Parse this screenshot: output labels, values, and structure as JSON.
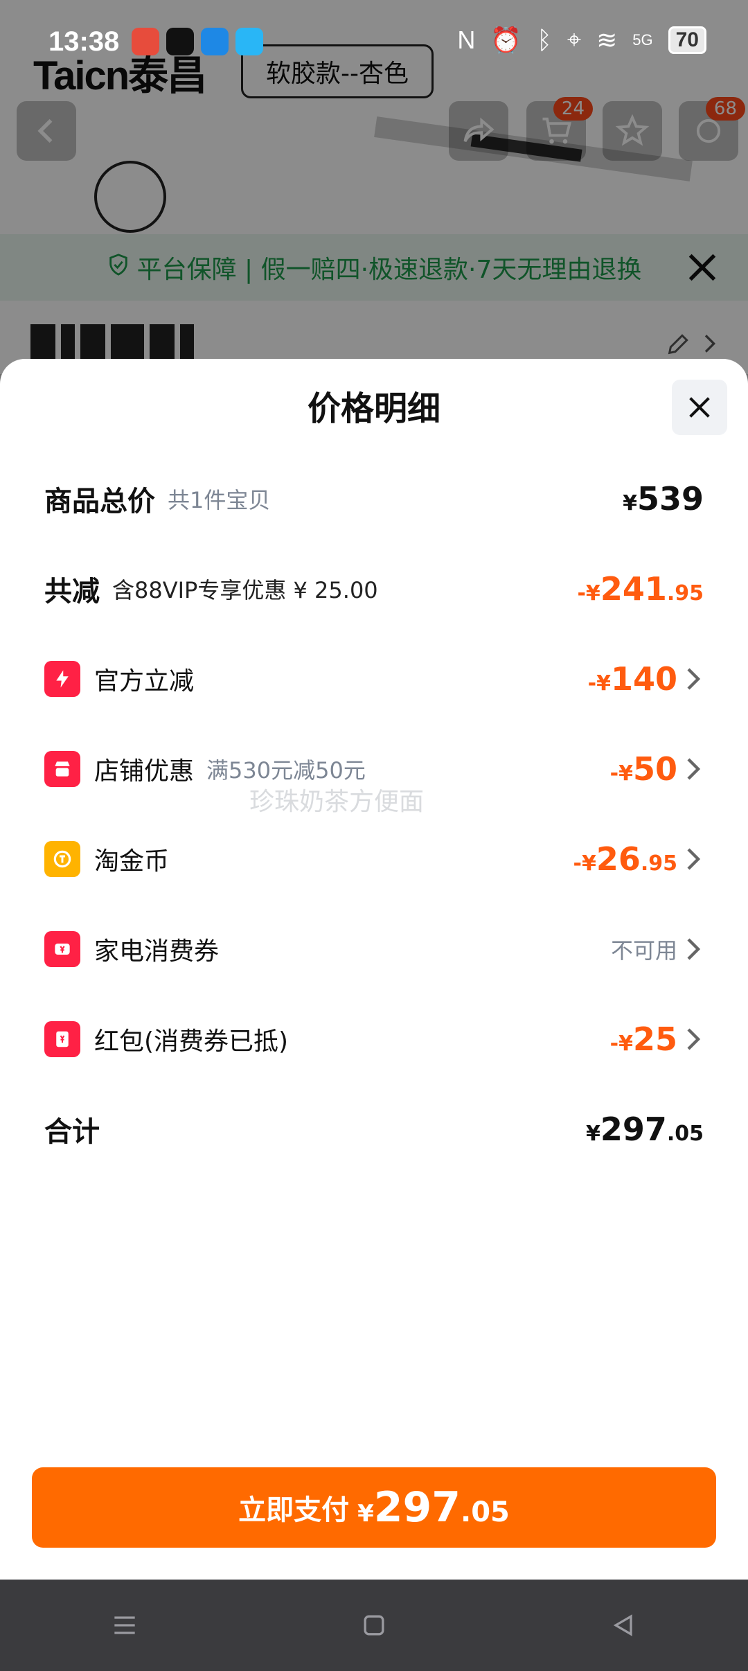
{
  "status_bar": {
    "time": "13:38",
    "battery": "70",
    "signal": "5G"
  },
  "background": {
    "brand": "Taicn泰昌",
    "variant": "软胶款--杏色",
    "cart_badge": "24",
    "message_badge": "68",
    "guarantee_text": "平台保障 | 假一赔四·极速退款·7天无理由退换"
  },
  "sheet": {
    "title": "价格明细",
    "watermark": "珍珠奶茶方便面",
    "total": {
      "label": "商品总价",
      "sub": "共1件宝贝",
      "symbol": "¥",
      "int": "539",
      "dec": ""
    },
    "reduction": {
      "label": "共减",
      "sub": "含88VIP专享优惠 ¥ 25.00",
      "symbol": "-¥",
      "int": "241",
      "dec": ".95"
    },
    "items": [
      {
        "label": "官方立减",
        "sub": "",
        "symbol": "-¥",
        "int": "140",
        "dec": "",
        "icon": "lightning-icon",
        "color": "#ff2145"
      },
      {
        "label": "店铺优惠",
        "sub": "满530元减50元",
        "symbol": "-¥",
        "int": "50",
        "dec": "",
        "icon": "store-icon",
        "color": "#ff2145"
      },
      {
        "label": "淘金币",
        "sub": "",
        "symbol": "-¥",
        "int": "26",
        "dec": ".95",
        "icon": "coin-icon",
        "color": "#ffb300"
      },
      {
        "label": "家电消费券",
        "sub": "",
        "status": "不可用",
        "icon": "coupon-icon",
        "color": "#ff2145"
      },
      {
        "label": "红包(消费券已抵)",
        "sub": "",
        "symbol": "-¥",
        "int": "25",
        "dec": "",
        "icon": "red-packet-icon",
        "color": "#ff2145"
      }
    ],
    "sum": {
      "label": "合计",
      "symbol": "¥",
      "int": "297",
      "dec": ".05"
    },
    "pay_button": {
      "label": "立即支付",
      "symbol": "¥",
      "int": "297",
      "dec": ".05"
    }
  },
  "colors": {
    "accent": "#ff6a00",
    "discount": "#ff5b0f",
    "guarantee": "#1e9a4c"
  }
}
